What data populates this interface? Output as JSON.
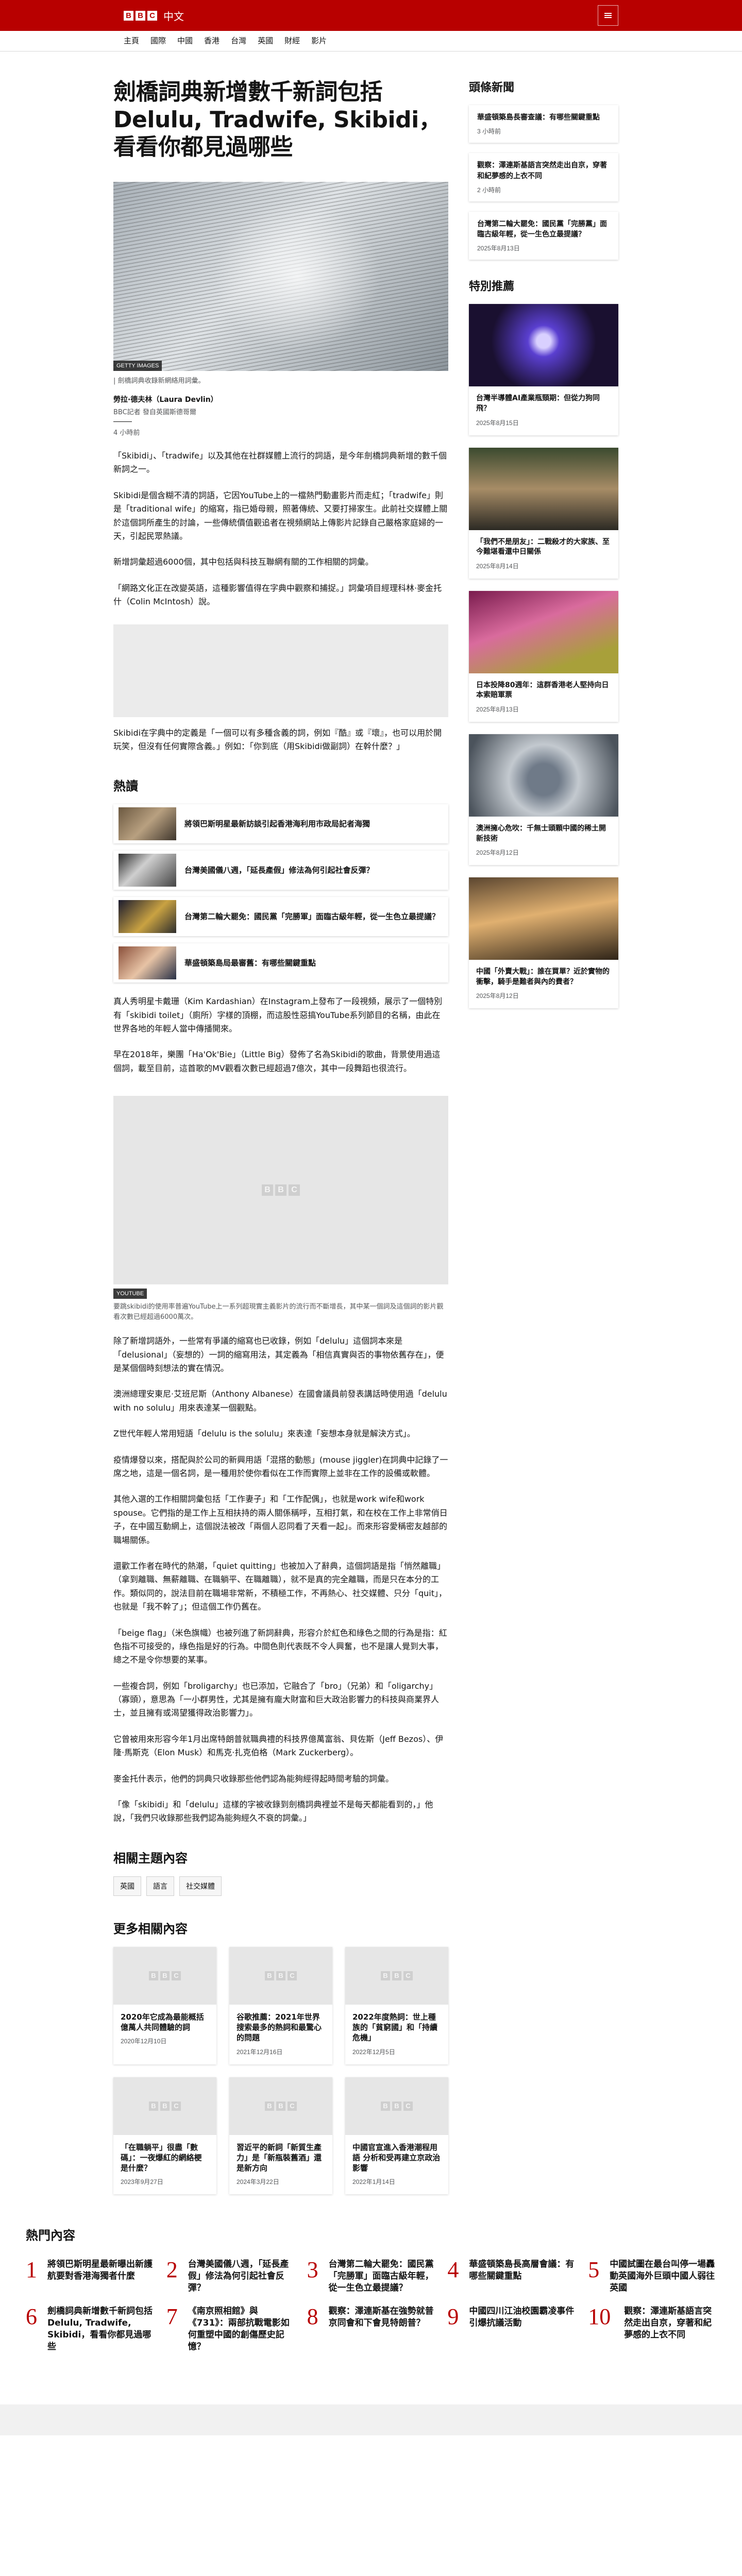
{
  "header": {
    "logo_letters": [
      "B",
      "B",
      "C"
    ],
    "lang": "中文",
    "nav": [
      "主頁",
      "國際",
      "中國",
      "香港",
      "台灣",
      "英國",
      "財經",
      "影片"
    ]
  },
  "article": {
    "headline": "劍橋詞典新增數千新詞包括Delulu, Tradwife, Skibidi，看看你都見過哪些",
    "hero_credit": "GETTY IMAGES",
    "hero_caption": "| 劍橋詞典收錄新網絡用詞彙。",
    "author": "勞拉·德夫林（Laura Devlin）",
    "author_role": "BBC記者 發自英國斯德哥爾",
    "date": "4 小時前",
    "paragraphs": [
      "「Skibidi」、「tradwife」以及其他在社群媒體上流行的詞語，是今年劍橋詞典新增的數千個新詞之一。",
      "Skibidi是個含糊不清的詞語，它因YouTube上的一檔熱門動畫影片而走紅；「tradwife」則是「traditional wife」的縮寫，指已婚母親，照著傳統、又要打掃家生。此前社交媒體上關於這個詞所產生的討論，一些傳統價值觀追者在視頻網站上傳影片記錄自己嚴格家庭婦的一天，引起民眾熱議。",
      "新增詞彙超過6000個，其中包括與科技互聯網有關的工作相關的詞彙。",
      "「網路文化正在改變英語，這種影響值得在字典中觀察和捕捉。」詞彙項目經理科林·麥金托什（Colin McIntosh）說。"
    ],
    "embed_caption": "Skibidi在字典中的定義是「一個可以有多種含義的詞，例如『酷』或『壞』，也可以用於開玩笑，但沒有任何實際含義。」例如：「你到底（用Skibidi做副詞）在幹什麼？」",
    "paragraphs_2": [
      "真人秀明星卡戴珊（Kim Kardashian）在Instagram上發布了一段視頻，展示了一個特別有「skibidi toilet」（廁所）字樣的頂棚，而這股性惡搞YouTube系列節目的名稱，由此在世界各地的年輕人當中傳播開來。",
      "早在2018年，樂團「Ha'Ok'Bie」（Little Big）發佈了名為Skibidi的歌曲，背景使用過這個詞，載至目前，這首歌的MV觀看次數已經超過7億次，其中一段舞蹈也很流行。"
    ],
    "video_tag": "YOUTUBE",
    "video_caption": "要跳skibidi的使用率普遍YouTube上一系列超現實主義影片的流行而不斷增長，其中某一個詞及這個詞的影片觀看次數已經超過6000萬次。",
    "paragraphs_3": [
      "除了新增詞語外，一些常有爭議的縮寫也已收錄，例如「delulu」這個詞本來是「delusional」（妄想的）一詞的縮寫用法，其定義為「相信真實與否的事物依舊存在」，便是某個個時刻想法的實在情況。",
      "澳洲總理安東尼·艾班尼斯（Anthony Albanese）在國會議員前發表講話時使用過「delulu with no solulu」用來表達某一個觀點。",
      "Z世代年輕人常用短語「delulu is the solulu」來表達「妄想本身就是解決方式」。",
      "疫情爆發以來，搭配與於公司的新興用語「混搭的動態」(mouse jiggler)在詞典中記錄了一席之地，這是一個名詞，是一種用於使你看似在工作而實際上並非在工作的設備或軟體。",
      "其他入選的工作相關詞彙包括「工作妻子」和「工作配偶」，也就是work wife和work spouse。它們指的是工作上互相扶持的兩人關係稱呼，互相打氣，和在校在工作上非常俏日子，在中國互動網上，這個說法被改「兩個人忍同看了天看一起」。而來形容愛稱密友越部的職場關係。",
      "還歡工作者在時代的熱潮，「quiet quitting」也被加入了辭典，這個詞語是指「悄然離職」（拿到離職、無薪離職、在職躺平、在職離職），就不是真的完全離職，而是只在本分的工作。類似同的，說法目前在職場非常新，不積極工作，不再熱心、社交媒體、只分「quit」，也就是「我不幹了」；但這個工作仍舊在。",
      "「beige flag」（米色旗幟）也被列進了新詞辭典，形容介於紅色和綠色之間的行為是指：紅色指不可接受的，綠色指是好的行為。中間色則代表既不令人興奮，也不是讓人覺到大事，總之不是令你想要的某事。",
      "一些複合詞，例如「broligarchy」也已添加，它融合了「bro」（兄弟）和「oligarchy」（寡頭），意思為「一小群男性，尤其是擁有龐大財富和巨大政治影響力的科技與商業界人士，並且擁有或渴望獲得政治影響力」。",
      "它曾被用來形容今年1月出席特朗普就職典禮的科技界億萬富翁、貝佐斯（Jeff Bezos）、伊隆·馬斯克（Elon Musk）和馬克·扎克伯格（Mark Zuckerberg）。",
      "麥金托什表示，他們的詞典只收錄那些他們認為能夠經得起時間考驗的詞彙。",
      "「像「skibidi」和「delulu」這樣的字被收錄到劍橋詞典裡並不是每天都能看到的，」他說，「我們只收錄那些我們認為能夠經久不衰的詞彙。」"
    ]
  },
  "hot": {
    "heading": "熱讀",
    "items": [
      "將領巴斯明星最新訪談引起香港海利用市政局記者海獨",
      "台灣美國儀八週，「延長產假」修法為何引起社會反彈？",
      "台灣第二輪大罷免：國民黨「完勝軍」面臨古級年輕，從一生色立最提議？",
      "華盛頓築島局最審舊：有哪些關鍵重點"
    ]
  },
  "topics": {
    "heading": "相關主題內容",
    "tags": [
      "英國",
      "語言",
      "社交媒體"
    ]
  },
  "related": {
    "heading": "更多相關內容",
    "items": [
      {
        "title": "2020年它成為最能概括億萬人共同體驗的詞",
        "date": "2020年12月10日"
      },
      {
        "title": "谷歌推薦：2021年世界搜索最多的熱詞和最驚心的問題",
        "date": "2021年12月16日"
      },
      {
        "title": "2022年度熱詞：世上種族的「貧窮國」和「持續危機」",
        "date": "2022年12月5日"
      },
      {
        "title": "「在職躺平」很盡「數碼」：一夜爆紅的網絡梗是什麼？",
        "date": "2023年9月27日"
      },
      {
        "title": "習近平的新詞「新質生產力」是「新瓶裝舊酒」還是新方向",
        "date": "2024年3月22日"
      },
      {
        "title": "中國官宣進入香港潮程用語 分析和受再建立京政治影響",
        "date": "2022年1月14日"
      }
    ]
  },
  "aside": {
    "latest_heading": "頭條新聞",
    "latest": [
      {
        "title": "華盛頓築島長審查議：有哪些關鍵重點",
        "time": "3 小時前"
      },
      {
        "title": "觀察：澤連斯基語言突然走出自京，穿著和紀夢感的上衣不同",
        "time": "2 小時前"
      },
      {
        "title": "台灣第二輪大罷免：國民黨「完勝黨」面臨古級年輕，從一生色立最提議？",
        "time": "2025年8月13日"
      }
    ],
    "featured_heading": "特別推薦",
    "featured": [
      {
        "title": "台灣半導體AI產業瓶頸期：但從力狗同飛？",
        "date": "2025年8月15日"
      },
      {
        "title": "「我們不是朋友」：二戰殺才的大家族、至今難堪看還中日關係",
        "date": "2025年8月14日"
      },
      {
        "title": "日本投降80週年：這群香港老人堅持向日本索賠軍票",
        "date": "2025年8月13日"
      },
      {
        "title": "澳洲擁心危吹：千無士頭顆中國的稀土開新技術",
        "date": "2025年8月12日"
      },
      {
        "title": "中國「外賣大戰」：誰在買單？近於實物的衝擊，騎手是難者與內的費者？",
        "date": "2025年8月12日"
      }
    ]
  },
  "mostread": {
    "heading": "熱門內容",
    "items": [
      {
        "num": "1",
        "title": "將領巴斯明星最新曝出新護航要對香港海獨者什麼"
      },
      {
        "num": "2",
        "title": "台灣美國儀八週，「延長產假」修法為何引起社會反彈？"
      },
      {
        "num": "3",
        "title": "台灣第二輪大罷免：國民黨「完勝軍」面臨古級年輕，從一生色立最提議？"
      },
      {
        "num": "4",
        "title": "華盛頓築島長高層會議：有哪些關鍵重點"
      },
      {
        "num": "5",
        "title": "中國試圖在最台叫停一場轟動英國海外巨頭中國人弱往英國"
      },
      {
        "num": "6",
        "title": "劍橋詞典新增數千新詞包括Delulu, Tradwife, Skibidi，看看你都見過哪些"
      },
      {
        "num": "7",
        "title": "《南京照相館》與《731》：兩部抗戰電影如何重塑中國的創傷歷史記憶？"
      },
      {
        "num": "8",
        "title": "觀察：澤連斯基在強勢就普京同會和下會見特朗普？"
      },
      {
        "num": "9",
        "title": "中國四川江油校園霸凌事件引爆抗議活動"
      },
      {
        "num": "10",
        "title": "觀察：澤連斯基語言突然走出自京，穿著和紀夢感的上衣不同"
      }
    ]
  }
}
